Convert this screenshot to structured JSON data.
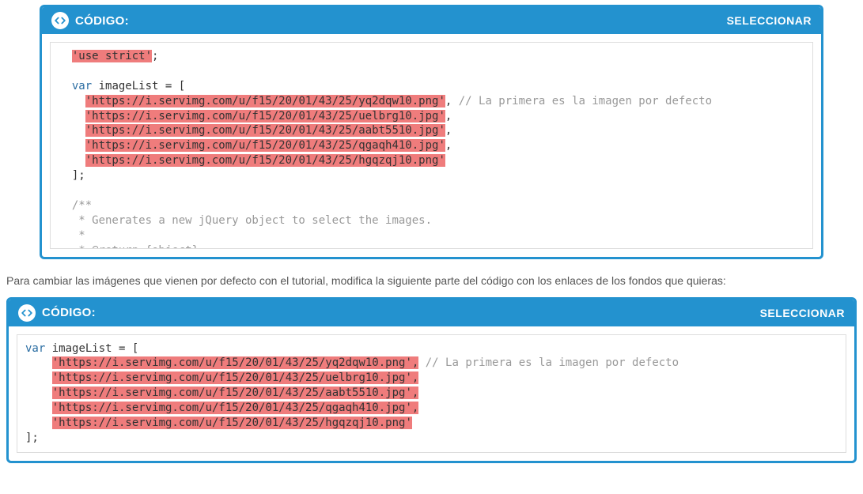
{
  "header": {
    "label": "CÓDIGO:",
    "select": "SELECCIONAR"
  },
  "box1": {
    "l1a": "'use strict'",
    "l1b": ";",
    "l2a": "var",
    "l2b": " imageList = [",
    "u1": "'https://i.servimg.com/u/f15/20/01/43/25/yq2dqw10.png'",
    "c1": ", ",
    "cm1": "// La primera es la imagen por defecto",
    "u2": "'https://i.servimg.com/u/f15/20/01/43/25/uelbrg10.jpg'",
    "c2": ",",
    "u3": "'https://i.servimg.com/u/f15/20/01/43/25/aabt5510.jpg'",
    "c3": ",",
    "u4": "'https://i.servimg.com/u/f15/20/01/43/25/qgaqh410.jpg'",
    "c4": ",",
    "u5": "'https://i.servimg.com/u/f15/20/01/43/25/hgqzqj10.png'",
    "close": "];",
    "d1": "/**",
    "d2": " * Generates a new jQuery object to select the images.",
    "d3": " *",
    "d4": " * @return {object}"
  },
  "explain": "Para cambiar las imágenes que vienen por defecto con el tutorial, modifica la siguiente parte del código con los enlaces de los fondos que quieras:",
  "box2": {
    "l1a": "var",
    "l1b": " imageList = [",
    "u1": "'https://i.servimg.com/u/f15/20/01/43/25/yq2dqw10.png',",
    "sp": " ",
    "cm1": "// La primera es la imagen por defecto",
    "u2": "'https://i.servimg.com/u/f15/20/01/43/25/uelbrg10.jpg',",
    "u3": "'https://i.servimg.com/u/f15/20/01/43/25/aabt5510.jpg',",
    "u4": "'https://i.servimg.com/u/f15/20/01/43/25/qgaqh410.jpg',",
    "u5": "'https://i.servimg.com/u/f15/20/01/43/25/hgqzqj10.png'",
    "close": "];"
  }
}
